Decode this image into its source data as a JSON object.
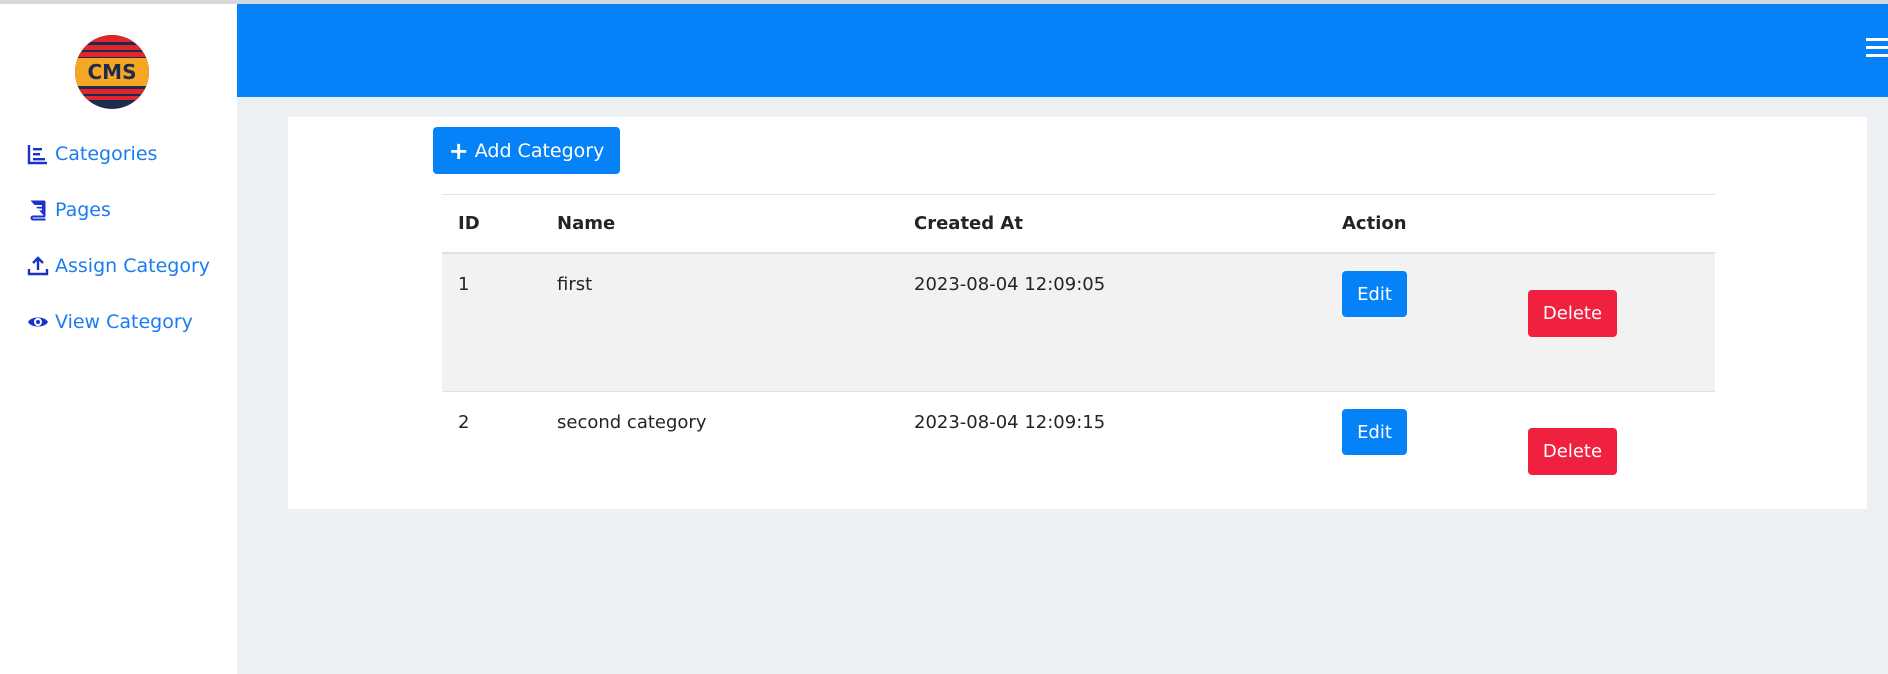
{
  "app": {
    "logo_text": "CMS",
    "brand_color": "#0582f7",
    "danger_color": "#f0203f"
  },
  "sidebar": {
    "items": [
      {
        "label": "Categories",
        "icon": "chart-bar-icon"
      },
      {
        "label": "Pages",
        "icon": "book-icon"
      },
      {
        "label": "Assign Category",
        "icon": "upload-icon"
      },
      {
        "label": "View Category",
        "icon": "eye-icon"
      }
    ]
  },
  "toolbar": {
    "add_label": "Add Category",
    "menu_icon": "hamburger-icon"
  },
  "table": {
    "headers": [
      "ID",
      "Name",
      "Created At",
      "Action"
    ],
    "rows": [
      {
        "id": "1",
        "name": "first",
        "created_at": "2023-08-04 12:09:05",
        "edit": "Edit",
        "delete": "Delete"
      },
      {
        "id": "2",
        "name": "second category",
        "created_at": "2023-08-04 12:09:15",
        "edit": "Edit",
        "delete": "Delete"
      }
    ]
  }
}
